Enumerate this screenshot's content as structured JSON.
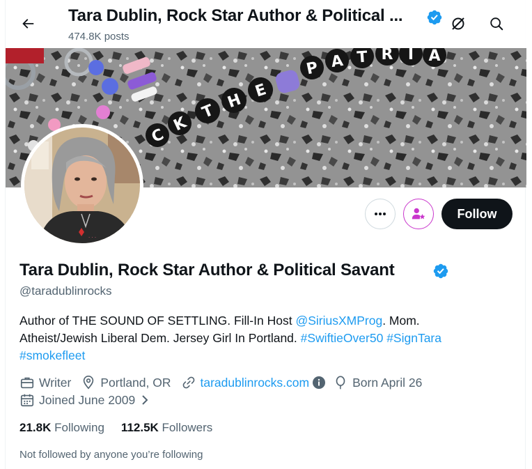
{
  "header": {
    "title": "Tara Dublin, Rock Star Author & Political ...",
    "posts": "474.8K posts"
  },
  "banner": {
    "beads_top": "PATRIOT",
    "beads_bottom": "ROCKTHE"
  },
  "actions": {
    "more_label": "•••",
    "follow_label": "Follow"
  },
  "profile": {
    "name": "Tara Dublin, Rock Star Author & Political Savant",
    "handle": "@taradublinrocks",
    "bio": {
      "p1": "Author of THE SOUND OF SETTLING. Fill-In Host ",
      "mention": "@SiriusXMProg",
      "p2": ". Mom.",
      "p3": "Atheist/Jewish Liberal Dem. Jersey Girl In Portland. ",
      "tag1": "#SwiftieOver50",
      "tag2": "#SignTara",
      "tag3": "#smokefleet"
    },
    "meta": {
      "profession": "Writer",
      "location": "Portland, OR",
      "website": "taradublinrocks.com",
      "birthday": "Born April 26",
      "joined": "Joined June 2009"
    },
    "stats": {
      "following_count": "21.8K",
      "following_label": "Following",
      "followers_count": "112.5K",
      "followers_label": "Followers"
    },
    "not_followed": "Not followed by anyone you’re following"
  },
  "colors": {
    "accent": "#1d9bf0",
    "verified": "#1d9bf0",
    "subscribe_icon": "#c936cc",
    "follow_bg": "#0f1419"
  },
  "icons": [
    "back-arrow-icon",
    "verified-badge-icon",
    "grok-icon",
    "search-icon",
    "more-icon",
    "subscribe-icon",
    "briefcase-icon",
    "location-icon",
    "link-icon",
    "info-icon",
    "balloon-icon",
    "calendar-icon",
    "chevron-right-icon"
  ]
}
